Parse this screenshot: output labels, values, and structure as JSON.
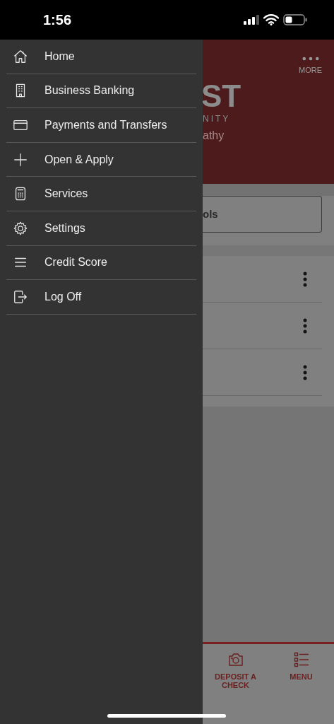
{
  "status_bar": {
    "time": "1:56"
  },
  "drawer": {
    "items": [
      {
        "label": "Home"
      },
      {
        "label": "Business Banking"
      },
      {
        "label": "Payments and Transfers"
      },
      {
        "label": "Open & Apply"
      },
      {
        "label": "Services"
      },
      {
        "label": "Settings"
      },
      {
        "label": "Credit Score"
      },
      {
        "label": "Log Off"
      }
    ]
  },
  "header": {
    "more_label": "MORE",
    "logo_fragment": "ST",
    "logo_subtitle_fragment": "NITY",
    "greeting_fragment": "athy"
  },
  "tools_button_fragment": "ols",
  "bottom_nav": {
    "items": [
      {
        "label": "DEPOSIT A CHECK"
      },
      {
        "label": "MENU"
      }
    ]
  }
}
